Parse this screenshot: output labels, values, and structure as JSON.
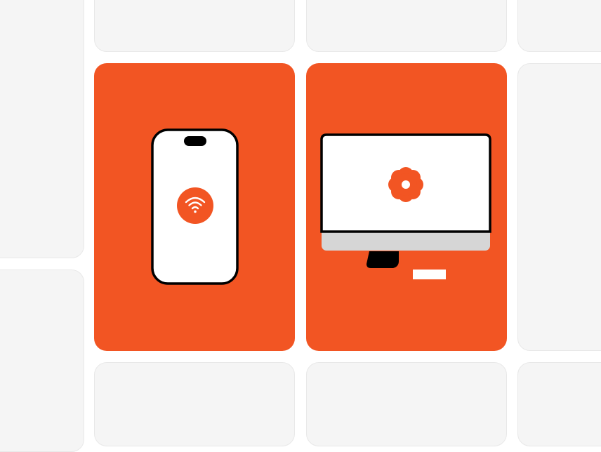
{
  "theme": {
    "accent": "#f25523",
    "tile_bg": "#f5f5f5",
    "tile_border": "#e8e8e8",
    "screen": "#ffffff",
    "outline": "#000000",
    "monitor_chin": "#d6d6d6"
  },
  "grid": {
    "background_tiles": [
      {
        "name": "tile-top-left"
      },
      {
        "name": "tile-top-center-left"
      },
      {
        "name": "tile-top-center-right"
      },
      {
        "name": "tile-top-right"
      },
      {
        "name": "tile-middle-left"
      },
      {
        "name": "tile-middle-right"
      },
      {
        "name": "tile-bottom-left"
      },
      {
        "name": "tile-bottom-center-left"
      },
      {
        "name": "tile-bottom-center-right"
      },
      {
        "name": "tile-bottom-right"
      }
    ],
    "feature_cards": [
      {
        "name": "smartphone-card",
        "device_icon": "smartphone-icon",
        "badge_icon": "wifi-icon"
      },
      {
        "name": "desktop-monitor-card",
        "device_icon": "monitor-icon",
        "badge_icon": "flower-gear-icon"
      }
    ]
  }
}
